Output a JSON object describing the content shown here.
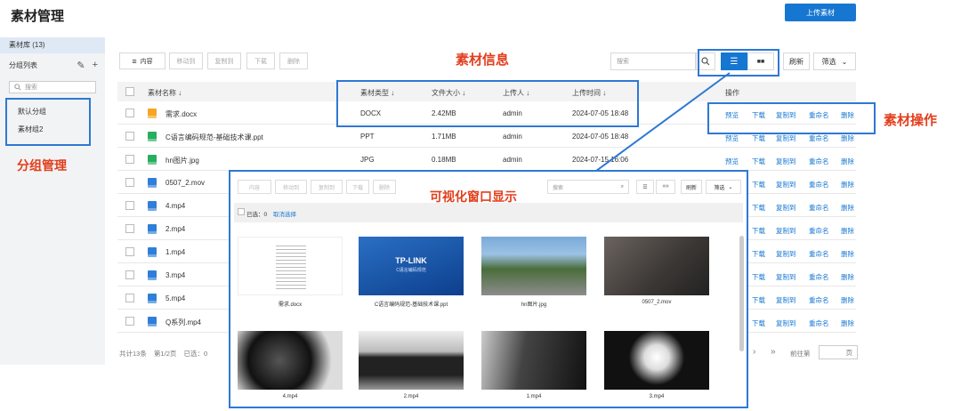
{
  "page_title": "素材管理",
  "upload_label": "上传素材",
  "sidebar": {
    "library_label": "素材库 (13)",
    "group_list_label": "分组列表",
    "edit_icon_glyph": "✎",
    "add_icon_glyph": "+",
    "search_placeholder": "搜索",
    "groups": [
      "默认分组",
      "素材组2"
    ]
  },
  "toolbar": {
    "content_label": "内容",
    "move_label": "移动到",
    "copy_label": "复制到",
    "download_label": "下载",
    "delete_label": "删除",
    "search_placeholder": "搜索",
    "refresh_label": "刷新",
    "filter_label": "筛选"
  },
  "annotations": {
    "material_info": "素材信息",
    "material_ops": "素材操作",
    "group_mgmt": "分组管理",
    "visual_window": "可视化窗口显示"
  },
  "table": {
    "headers": {
      "name": "素材名称 ↓",
      "type": "素材类型 ↓",
      "size": "文件大小 ↓",
      "uploader": "上传人 ↓",
      "time": "上传时间 ↓",
      "ops": "操作"
    },
    "rows": [
      {
        "name": "需求.docx",
        "type": "DOCX",
        "size": "2.42MB",
        "uploader": "admin",
        "time": "2024-07-05 18:48",
        "icon": "docx-icon",
        "color": "#f5a623"
      },
      {
        "name": "C语言编码规范-基础技术课.ppt",
        "type": "PPT",
        "size": "1.71MB",
        "uploader": "admin",
        "time": "2024-07-05 18:48",
        "icon": "ppt-icon",
        "color": "#27ae60"
      },
      {
        "name": "hn图片.jpg",
        "type": "JPG",
        "size": "0.18MB",
        "uploader": "admin",
        "time": "2024-07-15 16:06",
        "icon": "image-icon",
        "color": "#27ae60"
      },
      {
        "name": "0507_2.mov",
        "icon": "video-icon",
        "color": "#2f7fd8"
      },
      {
        "name": "4.mp4",
        "icon": "video-icon",
        "color": "#2f7fd8"
      },
      {
        "name": "2.mp4",
        "icon": "video-icon",
        "color": "#2f7fd8"
      },
      {
        "name": "1.mp4",
        "icon": "video-icon",
        "color": "#2f7fd8"
      },
      {
        "name": "3.mp4",
        "icon": "video-icon",
        "color": "#2f7fd8"
      },
      {
        "name": "5.mp4",
        "icon": "video-icon",
        "color": "#2f7fd8"
      },
      {
        "name": "Q系列.mp4",
        "icon": "video-icon",
        "color": "#2f7fd8"
      }
    ],
    "ops": [
      "预览",
      "下载",
      "复制到",
      "重命名",
      "删除"
    ]
  },
  "footer": {
    "total": "共计13条",
    "page": "第1/2页",
    "selected": "已选：0",
    "next": "›",
    "last": "»",
    "goto": "前往第",
    "page_unit": "页"
  },
  "overlay": {
    "content_label": "内容",
    "move_label": "移动到",
    "copy_label": "复制到",
    "download_label": "下载",
    "delete_label": "删除",
    "search_placeholder": "搜索",
    "refresh_label": "刷新",
    "filter_label": "筛选",
    "selected_text": "已选：0",
    "cancel_select": "取消选择",
    "thumb_logo": "TP-LINK",
    "thumb_logo_sub": "C语言编码规范",
    "thumbs": [
      "需求.docx",
      "C语言编码规范-基础技术课.ppt",
      "hn图片.jpg",
      "0507_2.mov",
      "4.mp4",
      "2.mp4",
      "1.mp4",
      "3.mp4"
    ]
  },
  "colors": {
    "accent": "#1677d2",
    "annotation_red": "#e23e1b",
    "box_blue": "#2e78d4"
  }
}
